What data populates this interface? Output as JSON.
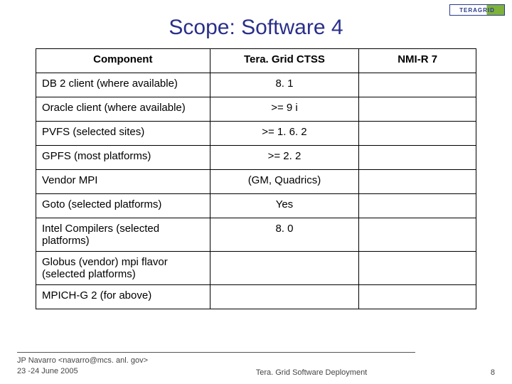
{
  "logo": "TERAGRID",
  "title": "Scope: Software 4",
  "table": {
    "headers": [
      "Component",
      "Tera. Grid CTSS",
      "NMI-R 7"
    ],
    "rows": [
      {
        "component": "DB 2 client (where available)",
        "ctss": "8. 1",
        "nmi": ""
      },
      {
        "component": "Oracle client (where available)",
        "ctss": ">= 9 i",
        "nmi": ""
      },
      {
        "component": "PVFS (selected sites)",
        "ctss": ">= 1. 6. 2",
        "nmi": ""
      },
      {
        "component": "GPFS (most platforms)",
        "ctss": ">= 2. 2",
        "nmi": ""
      },
      {
        "component": "Vendor MPI",
        "ctss": "(GM, Quadrics)",
        "nmi": ""
      },
      {
        "component": "Goto (selected platforms)",
        "ctss": "Yes",
        "nmi": ""
      },
      {
        "component": "Intel Compilers (selected platforms)",
        "ctss": "8. 0",
        "nmi": ""
      },
      {
        "component": "Globus (vendor) mpi flavor (selected platforms)",
        "ctss": "",
        "nmi": ""
      },
      {
        "component": "MPICH-G 2 (for above)",
        "ctss": "",
        "nmi": ""
      }
    ]
  },
  "footer": {
    "author": "JP Navarro <navarro@mcs. anl. gov>",
    "date": "23 -24 June 2005",
    "center": "Tera. Grid Software Deployment",
    "page": "8"
  }
}
